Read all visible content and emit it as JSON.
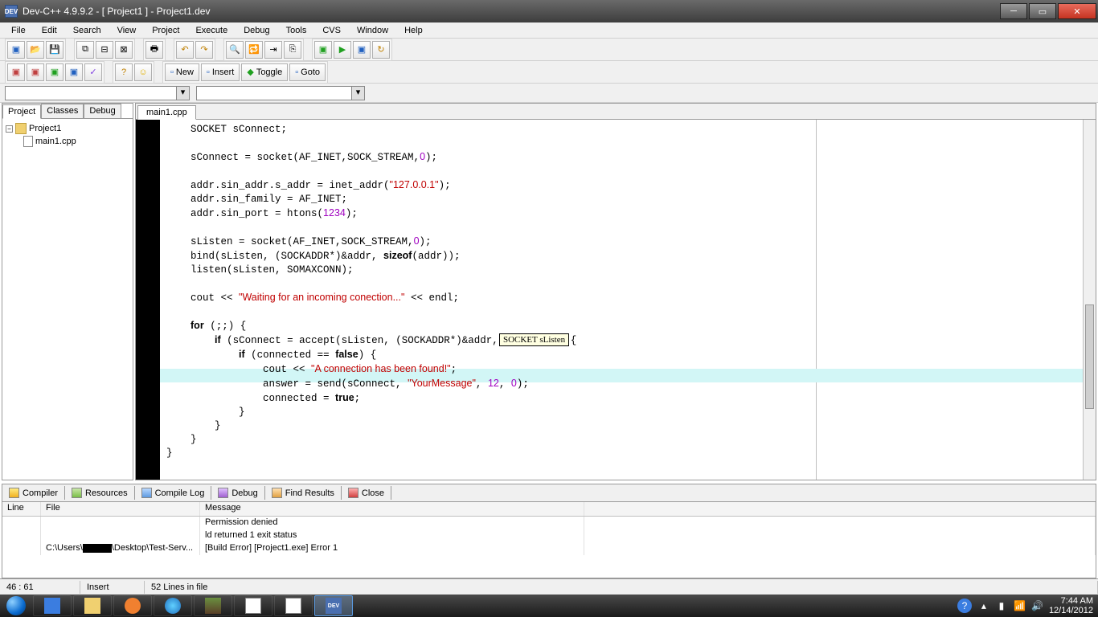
{
  "window": {
    "title": "Dev-C++ 4.9.9.2  -  [ Project1 ] - Project1.dev",
    "app_abbrev": "DEV"
  },
  "menu": [
    "File",
    "Edit",
    "Search",
    "View",
    "Project",
    "Execute",
    "Debug",
    "Tools",
    "CVS",
    "Window",
    "Help"
  ],
  "toolbar2": {
    "new": "New",
    "insert": "Insert",
    "toggle": "Toggle",
    "goto": "Goto"
  },
  "left_tabs": [
    "Project",
    "Classes",
    "Debug"
  ],
  "tree": {
    "root": "Project1",
    "child": "main1.cpp"
  },
  "editor_tab": "main1.cpp",
  "tooltip": "SOCKET sListen",
  "code_lines": [
    {
      "t": "    SOCKET sConnect;"
    },
    {
      "t": ""
    },
    {
      "t": "    sConnect = socket(AF_INET,SOCK_STREAM,",
      "n": "0",
      "t2": ");"
    },
    {
      "t": ""
    },
    {
      "t": "    addr.sin_addr.s_addr = inet_addr(",
      "s": "\"127.0.0.1\"",
      "t2": ");"
    },
    {
      "t": "    addr.sin_family = AF_INET;"
    },
    {
      "t": "    addr.sin_port = htons(",
      "n": "1234",
      "t2": ");"
    },
    {
      "t": ""
    },
    {
      "t": "    sListen = socket(AF_INET,SOCK_STREAM,",
      "n": "0",
      "t2": ");"
    },
    {
      "t": "    bind(sListen, (SOCKADDR*)&addr, ",
      "kw": "sizeof",
      "t2": "(addr));"
    },
    {
      "t": "    listen(sListen, SOMAXCONN);"
    },
    {
      "t": ""
    },
    {
      "t": "    cout << ",
      "s": "\"Waiting for an incoming conection...\"",
      "t2": " << endl;"
    },
    {
      "t": ""
    },
    {
      "kw": "    for",
      "t": " (;;) {"
    },
    {
      "kw": "        if",
      "t": " (sConnect = accept(sListen, (SOCKADDR*)&addr, &addrlen)) {"
    },
    {
      "kw": "            if",
      "t": " (connected == ",
      "kw2": "false",
      "t2": ") {"
    },
    {
      "t": "                cout << ",
      "s": "\"A connection has been found!\"",
      "t2": ";"
    },
    {
      "t": "                answer = send(sConnect, ",
      "s": "\"YourMessage\"",
      "t2": ", ",
      "n": "12",
      "t3": ", ",
      "n2": "0",
      "t4": ");",
      "hl": true
    },
    {
      "t": "                connected = ",
      "kw": "true",
      "t2": ";"
    },
    {
      "t": "            }"
    },
    {
      "t": "        }"
    },
    {
      "t": "    }"
    },
    {
      "t": "}"
    }
  ],
  "bottom_tabs": [
    "Compiler",
    "Resources",
    "Compile Log",
    "Debug",
    "Find Results",
    "Close"
  ],
  "msg_headers": {
    "line": "Line",
    "file": "File",
    "message": "Message"
  },
  "msg_rows": [
    {
      "line": "",
      "file": "",
      "message": "Permission denied"
    },
    {
      "line": "",
      "file": "",
      "message": "ld returned 1 exit status"
    },
    {
      "line": "",
      "file": "C:\\Users\\▮▮▮\\Desktop\\Test-Serv...",
      "file_has_redact": true,
      "message": "[Build Error]  [Project1.exe] Error 1"
    }
  ],
  "status": {
    "pos": "46 : 61",
    "mode": "Insert",
    "lines": "52 Lines in file"
  },
  "tray": {
    "time": "7:44 AM",
    "date": "12/14/2012"
  }
}
